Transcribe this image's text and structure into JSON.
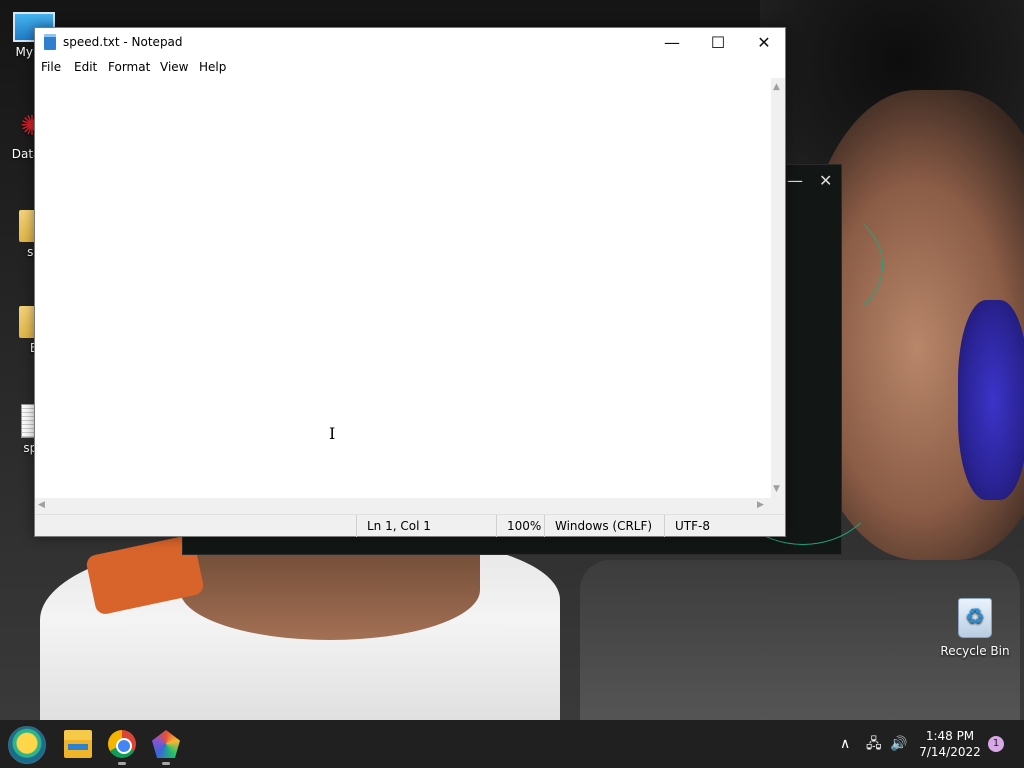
{
  "desktop": {
    "icons": [
      {
        "label": "My Co",
        "icon": "computer-icon"
      },
      {
        "label": "DataW",
        "icon": "datawarrior-icon"
      },
      {
        "label": "sp",
        "icon": "folder-icon"
      },
      {
        "label": "B",
        "icon": "folder-icon"
      },
      {
        "label": "spe",
        "icon": "text-file-icon"
      }
    ],
    "recycle_bin": {
      "label": "Recycle Bin",
      "icon": "recycle-bin-icon"
    }
  },
  "notepad": {
    "title": "speed.txt - Notepad",
    "menu": [
      "File",
      "Edit",
      "Format",
      "View",
      "Help"
    ],
    "content": "",
    "status": {
      "position": "Ln 1, Col 1",
      "zoom": "100%",
      "line_ending": "Windows (CRLF)",
      "encoding": "UTF-8"
    },
    "controls": {
      "minimize": "—",
      "maximize": "☐",
      "close": "✕"
    }
  },
  "background_window": {
    "controls": {
      "minimize": "—",
      "close": "✕"
    }
  },
  "taskbar": {
    "apps": [
      "start",
      "file-explorer",
      "chrome",
      "paint"
    ],
    "tray": {
      "chevron": "∧",
      "network": "🖧",
      "volume": "🔊"
    },
    "clock": {
      "time": "1:48 PM",
      "date": "7/14/2022"
    },
    "notifications": "1"
  },
  "colors": {
    "taskbar": "#202020",
    "notepad_bg": "#ffffff",
    "status_bg": "#f0f0f0",
    "accent_green": "#1fa57d"
  }
}
